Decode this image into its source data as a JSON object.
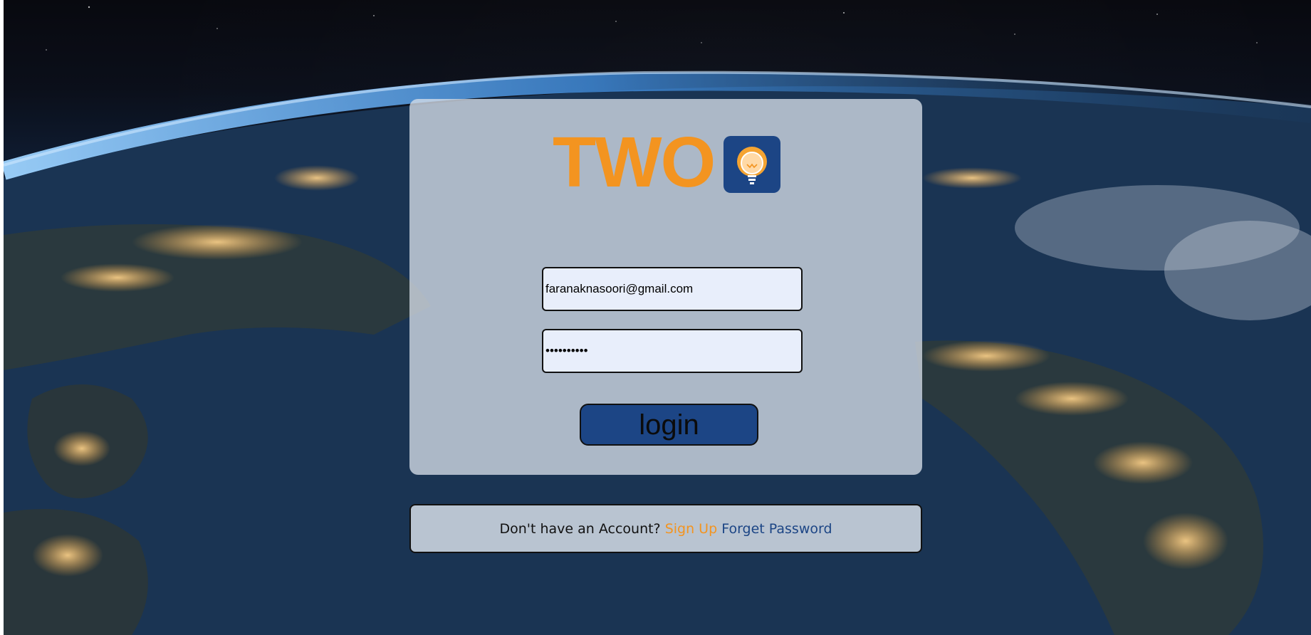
{
  "logo": {
    "text": "TWO",
    "badge_icon": "lightbulb-icon"
  },
  "login_form": {
    "email_value": "faranaknasoori@gmail.com",
    "password_value": "••••••••••",
    "login_label": "login"
  },
  "footer": {
    "prompt": "Don't have an Account? ",
    "signup_label": "Sign Up",
    "forget_label": "Forget Password"
  },
  "colors": {
    "brand_orange": "#f39420",
    "brand_blue": "#1c4585"
  }
}
